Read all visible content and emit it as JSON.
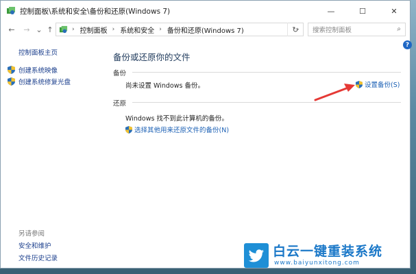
{
  "window": {
    "title": "控制面板\\系统和安全\\备份和还原(Windows 7)",
    "controls": {
      "minimize": "—",
      "maximize": "☐",
      "close": "✕"
    }
  },
  "nav": {
    "back": "←",
    "forward": "→",
    "recent": "⌄",
    "up": "↑",
    "breadcrumb": [
      "控制面板",
      "系统和安全",
      "备份和还原(Windows 7)"
    ],
    "separator": "›",
    "dropdown": "⌄",
    "refresh": "↻",
    "search_placeholder": "搜索控制面板",
    "search_icon": "⌕"
  },
  "sidebar": {
    "home": "控制面板主页",
    "items": [
      "创建系统映像",
      "创建系统修复光盘"
    ],
    "see_also_header": "另请参阅",
    "see_also": [
      "安全和维护",
      "文件历史记录"
    ]
  },
  "main": {
    "title": "备份或还原你的文件",
    "backup_section": "备份",
    "backup_status": "尚未设置 Windows 备份。",
    "setup_backup": "设置备份(S)",
    "restore_section": "还原",
    "restore_status": "Windows 找不到此计算机的备份。",
    "select_other_backup": "选择其他用来还原文件的备份(N)"
  },
  "help_label": "?",
  "watermark": {
    "name": "白云一键重装系统",
    "url": "www.baiyunxitong.com"
  },
  "colors": {
    "link": "#1a5fb4",
    "sidebar_link": "#1a3e8c",
    "title": "#1e395b",
    "arrow": "#e53935",
    "watermark": "#1b78c8"
  },
  "icons": {
    "app": "control-panel-icon",
    "shield": "uac-shield-icon",
    "bird": "twitter-bird-icon"
  }
}
